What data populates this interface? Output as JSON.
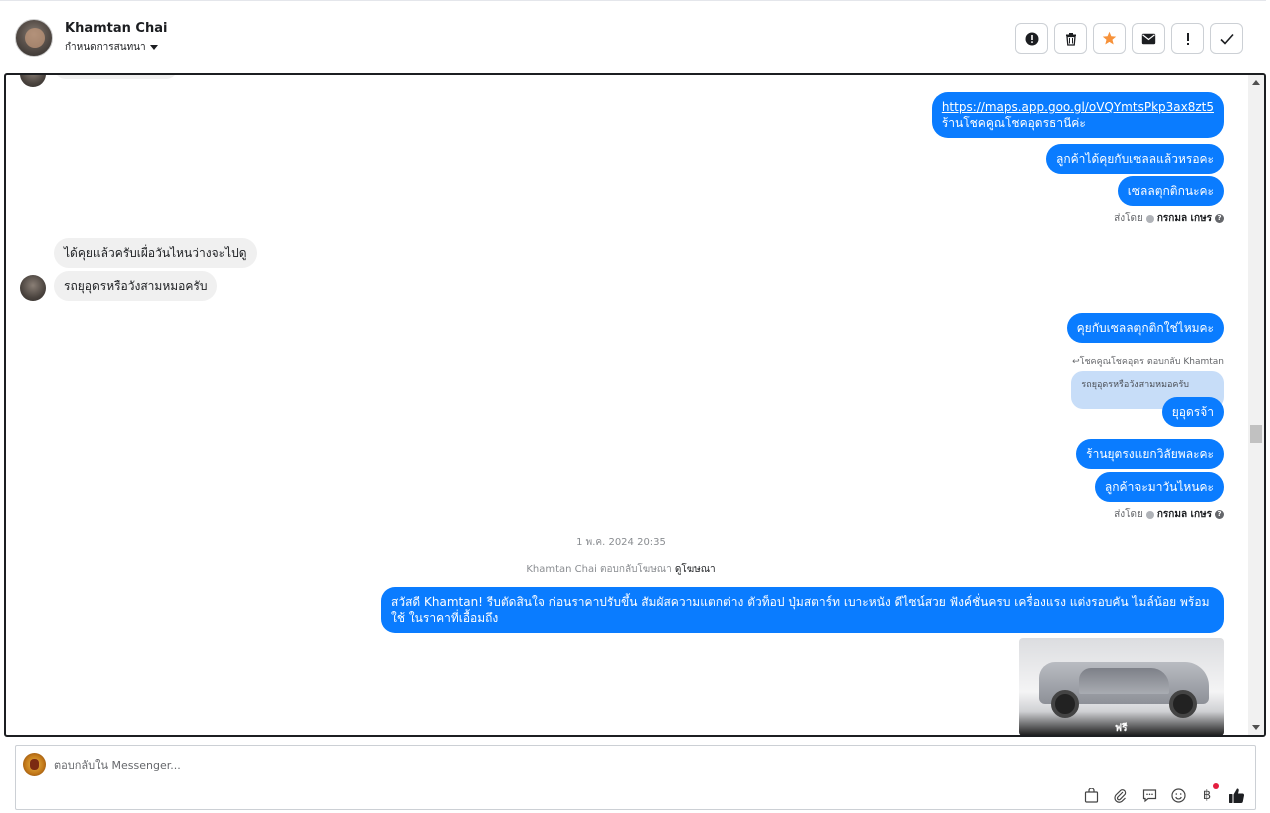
{
  "header": {
    "name": "Khamtan Chai",
    "assign_label": "กำหนดการสนทนา",
    "actions": [
      {
        "icon": "alert-circle-icon"
      },
      {
        "icon": "trash-icon"
      },
      {
        "icon": "star-icon"
      },
      {
        "icon": "envelope-icon"
      },
      {
        "icon": "exclamation-icon"
      },
      {
        "icon": "check-icon"
      }
    ]
  },
  "messages": {
    "out1_link": "https://maps.app.goo.gl/oVQYmtsPkp3ax8zt5",
    "out1_text": "ร้านโชคคูณโชคอุดรธานีค่ะ",
    "out2": "ลูกค้าได้คุยกับเซลลแล้วหรอคะ",
    "out3": "เซลลตุกติกนะคะ",
    "sent_by_label": "ส่งโดย",
    "sent_by_name": "กรกมล เกษร",
    "in1": "ได้คุยแล้วครับเผื่อวันไหนว่างจะไปดู",
    "in2": "รถยุอุดรหรือวังสามหมอครับ",
    "out4": "คุยกับเซลลตุกติกใช่ไหมคะ",
    "reply_note": "โชคคูณโชคอุดร ตอบกลับ Khamtan",
    "quoted": "รถยุอุดรหรือวังสามหมอครับ",
    "out5": "ยุอุดรจ้า",
    "out6": "ร้านยุตรงแยกวิลัยพละคะ",
    "out7": "ลูกค้าจะมาวันไหนคะ",
    "sent_by_label_2": "ส่งโดย",
    "sent_by_name_2": "กรกมล เกษร",
    "timestamp": "1 พ.ค. 2024 20:35",
    "ad_reply_note": "Khamtan Chai ตอบกลับโฆษณา",
    "ad_view_link": "ดูโฆษณา",
    "out8": "สวัสดี Khamtan! รีบตัดสินใจ ก่อนราคาปรับขึ้น สัมผัสความแตกต่าง ตัวท็อป ปุ่มสตาร์ท เบาะหนัง ดีไซน์สวย ฟังค์ชั่นครบ เครื่องแรง แต่งรอบคัน ไมล์น้อย พร้อมใช้ ในราคาที่เอื้อมถึง",
    "car_caption": "ฟรี"
  },
  "composer": {
    "placeholder": "ตอบกลับใน Messenger...",
    "tools": [
      "bag-icon",
      "paperclip-icon",
      "chat-bubble-icon",
      "smiley-icon",
      "baht-icon",
      "thumbs-up-icon"
    ]
  },
  "colors": {
    "outgoing_bubble": "#0a7cff",
    "incoming_bubble": "#f0f0f0",
    "star": "#f7923a",
    "notification_dot": "#e41e3f"
  }
}
